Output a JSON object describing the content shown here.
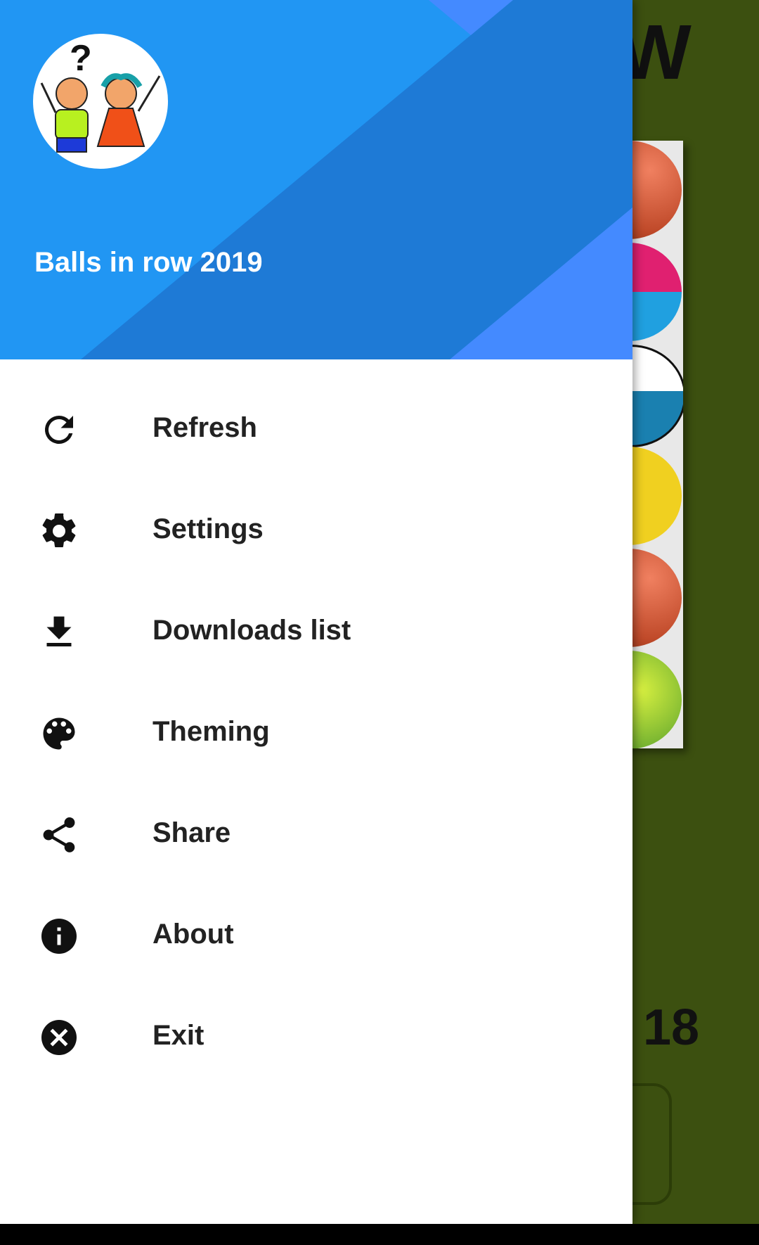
{
  "app": {
    "title": "Balls in row 2019"
  },
  "background": {
    "title_fragment": "W",
    "score": "18"
  },
  "menu": {
    "items": [
      {
        "label": "Refresh",
        "icon": "refresh-icon"
      },
      {
        "label": "Settings",
        "icon": "gear-icon"
      },
      {
        "label": "Downloads list",
        "icon": "download-icon"
      },
      {
        "label": "Theming",
        "icon": "palette-icon"
      },
      {
        "label": "Share",
        "icon": "share-icon"
      },
      {
        "label": "About",
        "icon": "info-icon"
      },
      {
        "label": "Exit",
        "icon": "close-circle-icon"
      }
    ]
  },
  "colors": {
    "header_light": "#2196f3",
    "header_mid": "#1e7ad6",
    "header_accent": "#448aff",
    "background_green": "#3c5010",
    "text_dark": "#222222"
  }
}
